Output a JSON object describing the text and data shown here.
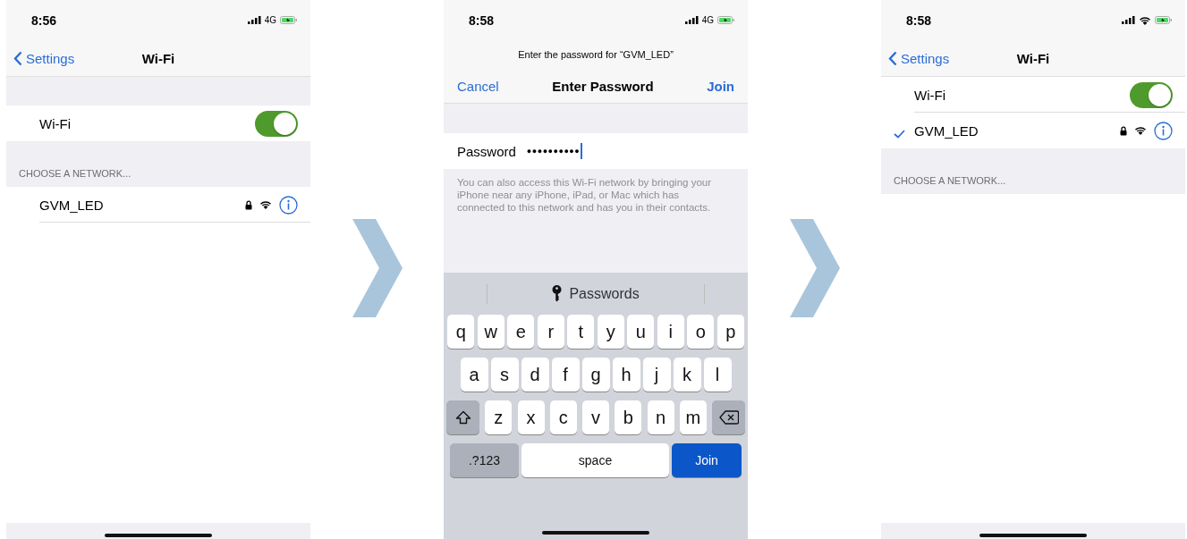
{
  "screens": [
    {
      "kind": "wifi_list",
      "time": "8:56",
      "connection": {
        "kind": "cellular",
        "label": "4G"
      },
      "back": "Settings",
      "title": "Wi-Fi",
      "rows": [
        {
          "kind": "gap"
        },
        {
          "kind": "toggle",
          "label": "Wi-Fi",
          "on": true
        },
        {
          "kind": "header",
          "label": "CHOOSE A NETWORK..."
        },
        {
          "kind": "network",
          "name": "GVM_LED",
          "connected": false,
          "locked": true
        }
      ]
    },
    {
      "kind": "password",
      "time": "8:58",
      "connection": {
        "kind": "cellular",
        "label": "4G"
      },
      "prompt": "Enter the password for “GVM_LED”",
      "cancel": "Cancel",
      "title": "Enter Password",
      "join": "Join",
      "field_label": "Password",
      "value": "●●●●●●●●●●",
      "note": "You can also access this Wi-Fi network by bringing your iPhone near any iPhone, iPad, or Mac which has connected to this network and has you in their contacts.",
      "suggestion": "Passwords",
      "keys": [
        [
          {
            "kind": "letter",
            "label": "q"
          },
          {
            "kind": "letter",
            "label": "w"
          },
          {
            "kind": "letter",
            "label": "e"
          },
          {
            "kind": "letter",
            "label": "r"
          },
          {
            "kind": "letter",
            "label": "t"
          },
          {
            "kind": "letter",
            "label": "y"
          },
          {
            "kind": "letter",
            "label": "u"
          },
          {
            "kind": "letter",
            "label": "i"
          },
          {
            "kind": "letter",
            "label": "o"
          },
          {
            "kind": "letter",
            "label": "p"
          }
        ],
        [
          {
            "kind": "letter",
            "label": "a"
          },
          {
            "kind": "letter",
            "label": "s"
          },
          {
            "kind": "letter",
            "label": "d"
          },
          {
            "kind": "letter",
            "label": "f"
          },
          {
            "kind": "letter",
            "label": "g"
          },
          {
            "kind": "letter",
            "label": "h"
          },
          {
            "kind": "letter",
            "label": "j"
          },
          {
            "kind": "letter",
            "label": "k"
          },
          {
            "kind": "letter",
            "label": "l"
          }
        ],
        [
          {
            "kind": "shift"
          },
          {
            "kind": "letter",
            "label": "z"
          },
          {
            "kind": "letter",
            "label": "x"
          },
          {
            "kind": "letter",
            "label": "c"
          },
          {
            "kind": "letter",
            "label": "v"
          },
          {
            "kind": "letter",
            "label": "b"
          },
          {
            "kind": "letter",
            "label": "n"
          },
          {
            "kind": "letter",
            "label": "m"
          },
          {
            "kind": "delete"
          }
        ],
        [
          {
            "kind": "mode",
            "label": ".?123"
          },
          {
            "kind": "space",
            "label": "space"
          },
          {
            "kind": "action",
            "label": "Join"
          }
        ]
      ]
    },
    {
      "kind": "wifi_list",
      "time": "8:58",
      "connection": {
        "kind": "wifi"
      },
      "back": "Settings",
      "title": "Wi-Fi",
      "rows": [
        {
          "kind": "toggle",
          "label": "Wi-Fi",
          "on": true
        },
        {
          "kind": "network",
          "name": "GVM_LED",
          "connected": true,
          "locked": true
        },
        {
          "kind": "header",
          "label": "CHOOSE A NETWORK..."
        }
      ]
    }
  ]
}
